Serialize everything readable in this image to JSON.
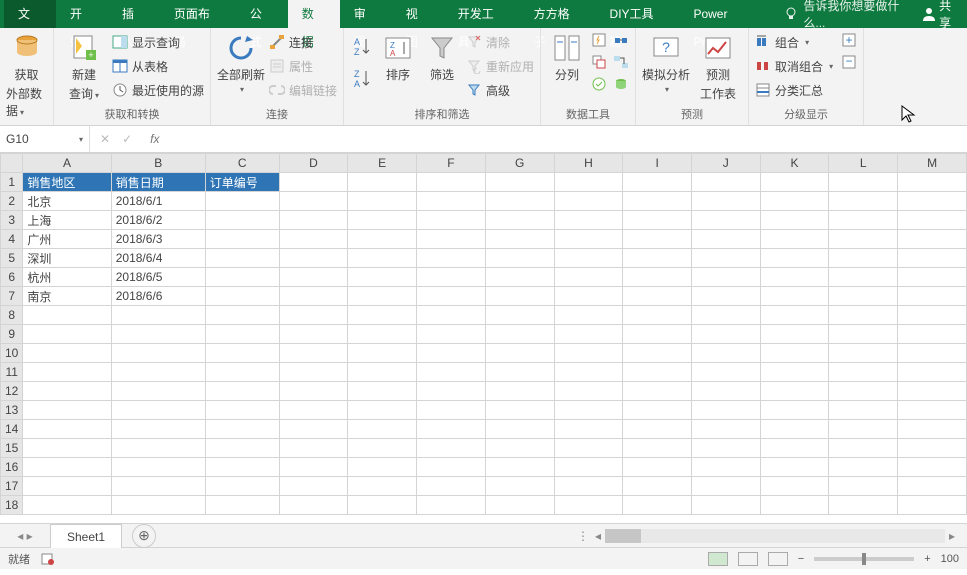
{
  "tabs": {
    "file": "文件",
    "home": "开始",
    "insert": "插入",
    "layout": "页面布局",
    "formula": "公式",
    "data": "数据",
    "review": "审阅",
    "view": "视图",
    "dev": "开发工具",
    "ffgz": "方方格子",
    "diy": "DIY工具箱",
    "pp": "Power Pivot"
  },
  "tellme": "告诉我你想要做什么...",
  "share": "共享",
  "ribbon": {
    "getdata": {
      "label1": "获取",
      "label2": "外部数据",
      "group": "获取和转换"
    },
    "newquery": {
      "label1": "新建",
      "label2": "查询",
      "show": "显示查询",
      "table": "从表格",
      "recent": "最近使用的源"
    },
    "refresh": {
      "label1": "全部刷新",
      "conn": "连接",
      "prop": "属性",
      "edit": "编辑链接",
      "group": "连接"
    },
    "sort": {
      "asc": "升序",
      "desc": "降序",
      "sortbtn": "排序",
      "filter": "筛选",
      "clear": "清除",
      "reapply": "重新应用",
      "adv": "高级",
      "group": "排序和筛选"
    },
    "tools": {
      "t2c": "分列",
      "group": "数据工具"
    },
    "forecast": {
      "whatif": "模拟分析",
      "sheet": "预测",
      "sheet2": "工作表",
      "group": "预测"
    },
    "outline": {
      "grp": "组合",
      "ungrp": "取消组合",
      "sub": "分类汇总",
      "group": "分级显示"
    }
  },
  "namebox": "G10",
  "fx": "",
  "columns": [
    "A",
    "B",
    "C",
    "D",
    "E",
    "F",
    "G",
    "H",
    "I",
    "J",
    "K",
    "L",
    "M"
  ],
  "headers": {
    "a": "销售地区",
    "b": "销售日期",
    "c": "订单编号"
  },
  "rows": [
    {
      "a": "北京",
      "b": "2018/6/1"
    },
    {
      "a": "上海",
      "b": "2018/6/2"
    },
    {
      "a": "广州",
      "b": "2018/6/3"
    },
    {
      "a": "深圳",
      "b": "2018/6/4"
    },
    {
      "a": "杭州",
      "b": "2018/6/5"
    },
    {
      "a": "南京",
      "b": "2018/6/6"
    }
  ],
  "sheet_name": "Sheet1",
  "status": {
    "ready": "就绪",
    "zoom": "100"
  }
}
